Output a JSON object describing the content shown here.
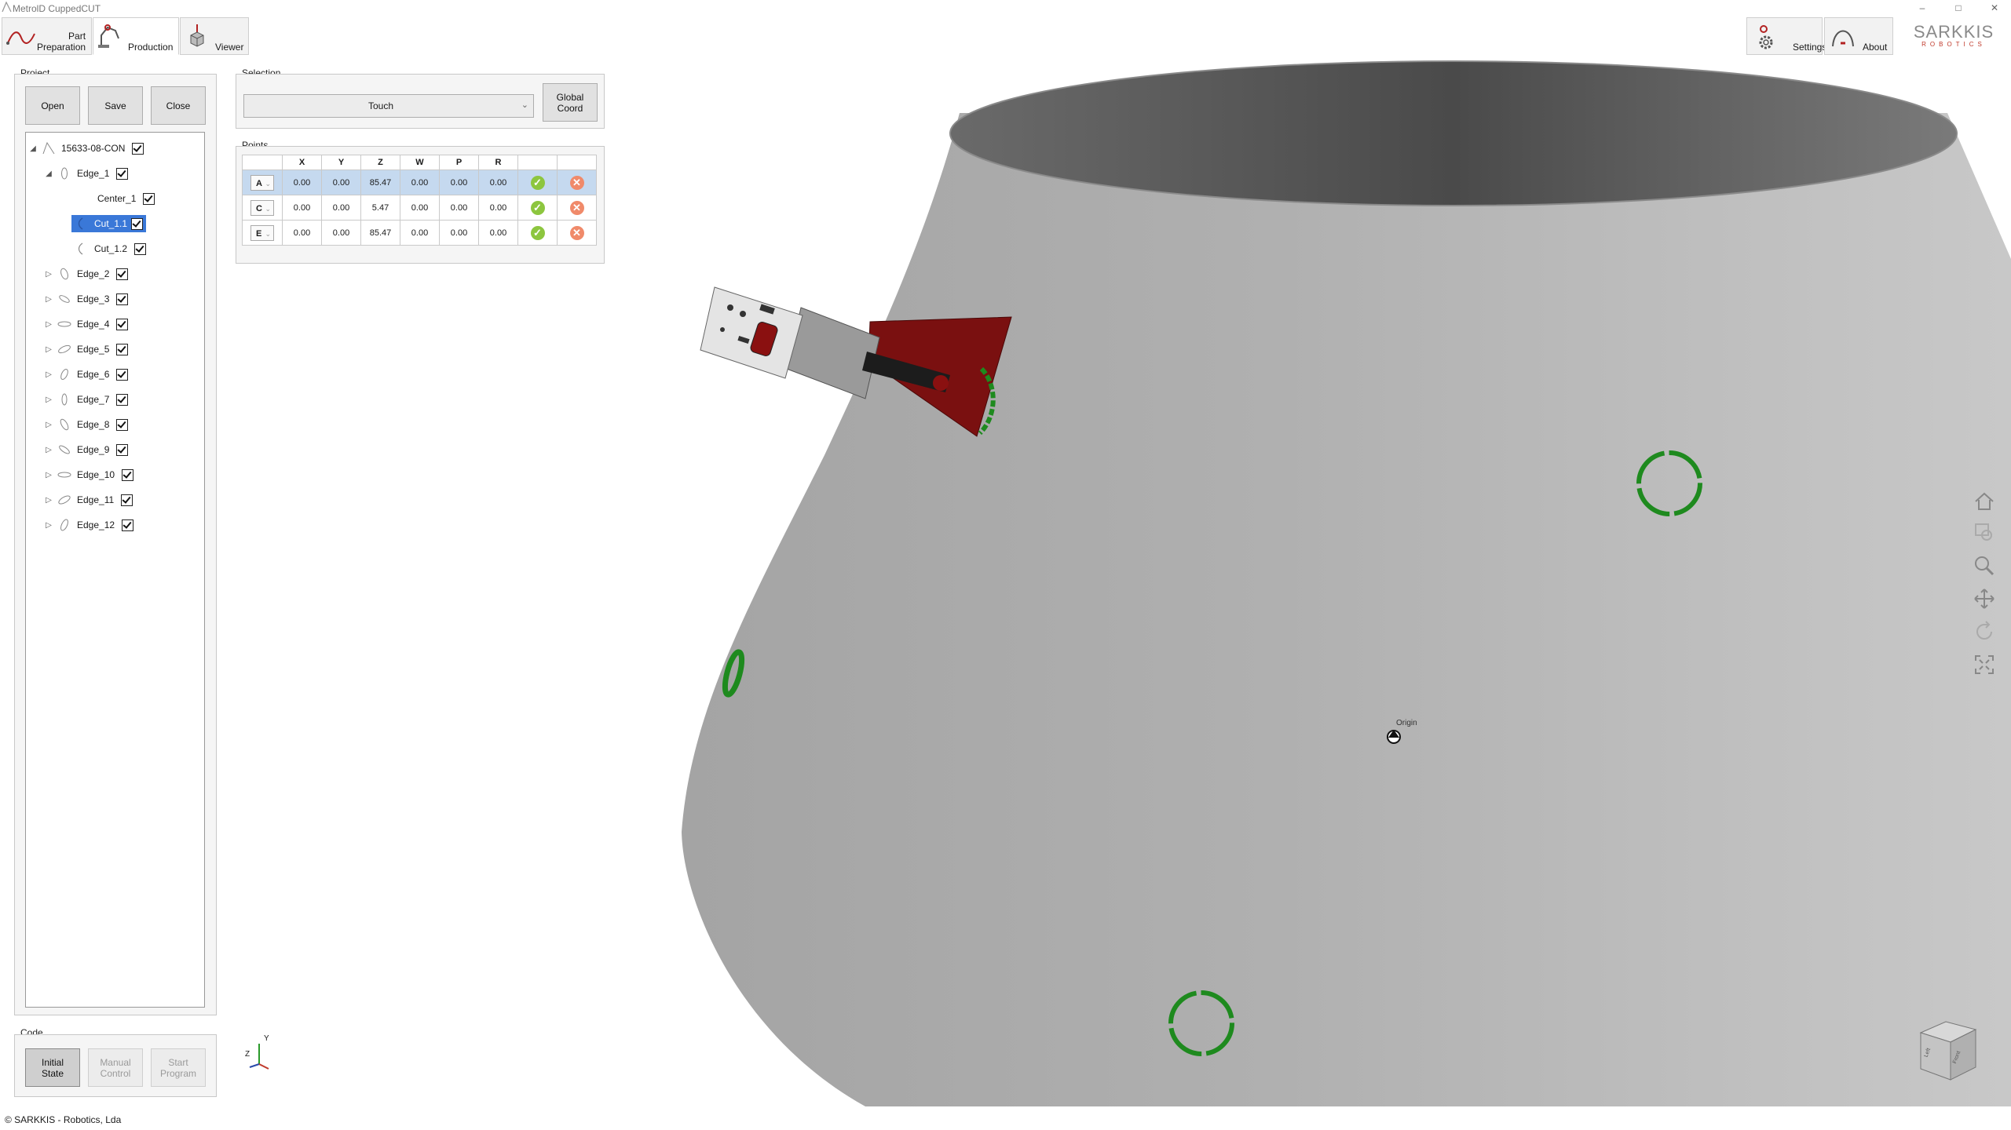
{
  "app": {
    "title": "MetrolD CuppedCUT",
    "footer": "© SARKKIS - Robotics, Lda"
  },
  "window_controls": [
    "–",
    "□",
    "✕"
  ],
  "ribbon": {
    "tabs": [
      {
        "label_line1": "Part",
        "label_line2": "Preparation",
        "icon": "part-preparation-icon",
        "active": false
      },
      {
        "label_line1": "",
        "label_line2": "Production",
        "icon": "production-icon",
        "active": true
      },
      {
        "label_line1": "",
        "label_line2": "Viewer",
        "icon": "viewer-icon",
        "active": false
      }
    ],
    "settings_label": "Settings",
    "about_label": "About",
    "brand_name": "SARKKIS",
    "brand_sub": "ROBOTICS"
  },
  "project": {
    "title": "Project",
    "open_label": "Open",
    "save_label": "Save",
    "close_label": "Close",
    "tree": {
      "root": "15633-08-CON",
      "edge1": "Edge_1",
      "children": [
        "Center_1",
        "Cut_1.1",
        "Cut_1.2"
      ],
      "edges": [
        "Edge_2",
        "Edge_3",
        "Edge_4",
        "Edge_5",
        "Edge_6",
        "Edge_7",
        "Edge_8",
        "Edge_9",
        "Edge_10",
        "Edge_11",
        "Edge_12"
      ],
      "selected": "Cut_1.1"
    }
  },
  "selection": {
    "title": "Selection",
    "mode_value": "Touch",
    "global_coord_line1": "Global",
    "global_coord_line2": "Coord"
  },
  "points": {
    "title": "Points",
    "columns": [
      "X",
      "Y",
      "Z",
      "W",
      "P",
      "R"
    ],
    "rows": [
      {
        "label": "A",
        "values": [
          "0.00",
          "0.00",
          "85.47",
          "0.00",
          "0.00",
          "0.00"
        ]
      },
      {
        "label": "C",
        "values": [
          "0.00",
          "0.00",
          "5.47",
          "0.00",
          "0.00",
          "0.00"
        ]
      },
      {
        "label": "E",
        "values": [
          "0.00",
          "0.00",
          "85.47",
          "0.00",
          "0.00",
          "0.00"
        ]
      }
    ],
    "ok_glyph": "✓",
    "del_glyph": "✕",
    "dropdown_glyph": "⌄"
  },
  "code": {
    "title": "Code",
    "initial_state_line1": "Initial",
    "initial_state_line2": "State",
    "manual_control_line1": "Manual",
    "manual_control_line2": "Control",
    "start_program_line1": "Start",
    "start_program_line2": "Program"
  },
  "viewport": {
    "origin_label": "Origin",
    "axis_y": "Y",
    "axis_z": "Z",
    "cube_label_left": "Left",
    "cube_label_front": "Front",
    "surface_color": "#a8a8a8",
    "cut_ring_color": "#1e8a1e",
    "bracket_color": "#7a1010"
  },
  "nav_tools": [
    "home-icon",
    "zoom-window-icon",
    "zoom-icon",
    "pan-icon",
    "rotate-icon",
    "fit-icon"
  ]
}
